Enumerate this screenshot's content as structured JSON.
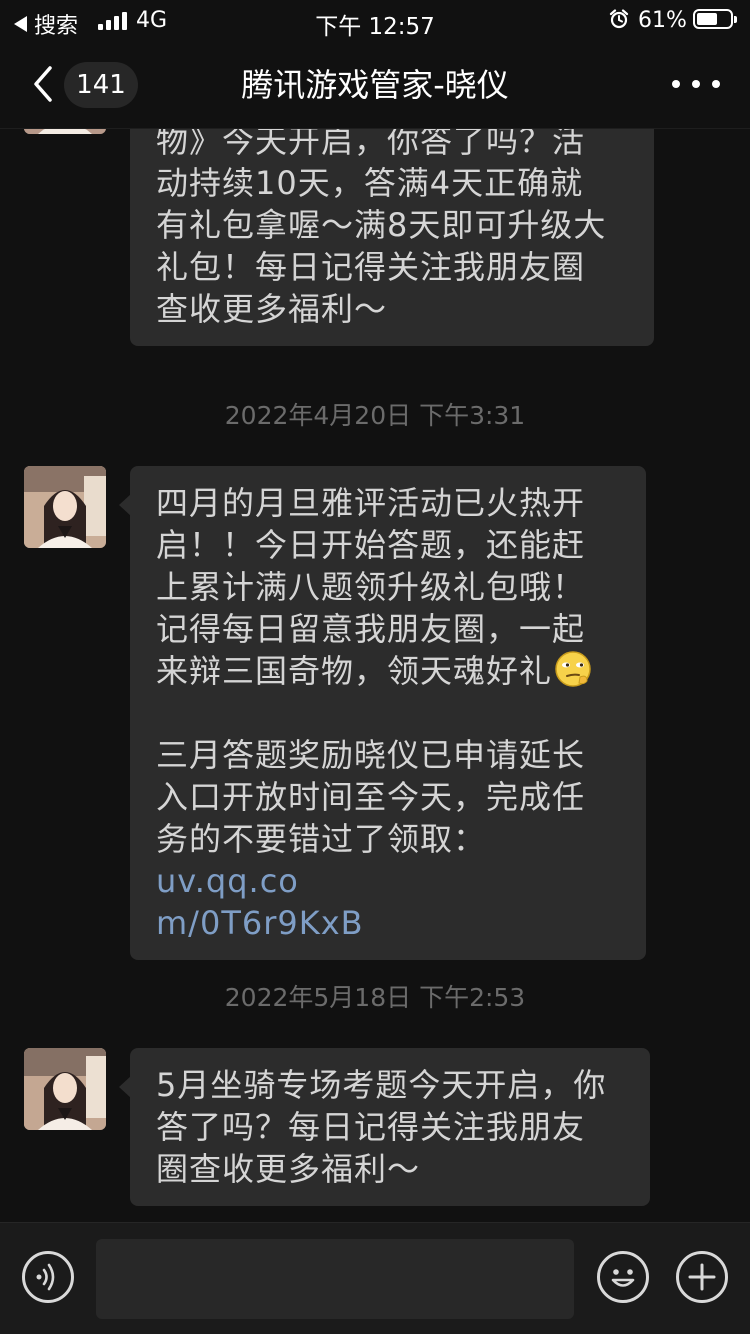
{
  "status_bar": {
    "back_app": "搜索",
    "network": "4G",
    "time": "下午 12:57",
    "battery": "61%",
    "battery_level": 0.61
  },
  "nav": {
    "unread_count": "141",
    "title": "腾讯游戏管家-晓仪",
    "back_icon": "chevron-left-icon",
    "more_icon": "more-dots-icon"
  },
  "messages": [
    {
      "id": "m1",
      "lines": [
        "物》今天开启，你答了吗？活",
        "动持续10天，答满4天正确就",
        "有礼包拿喔～满8天即可升级大",
        "礼包！每日记得关注我朋友圈",
        "查收更多福利～"
      ]
    },
    {
      "id": "m2",
      "timestamp": "2022年4月20日 下午3:31",
      "para1": [
        "四月的月旦雅评活动已火热开",
        "启！！今日开始答题，还能赶",
        "上累计满八题领升级礼包哦！",
        "记得每日留意我朋友圈，一起",
        "来辩三国奇物，领天魂好礼"
      ],
      "para2": [
        "三月答题奖励晓仪已申请延长",
        "入口开放时间至今天，完成任",
        "务的不要错过了领取："
      ],
      "link_part1": "uv.qq.co",
      "link_part2": "m/0T6r9KxB",
      "emoji_icon": "smirk-emoji-icon"
    },
    {
      "id": "m3",
      "timestamp": "2022年5月18日 下午2:53",
      "lines": [
        "5月坐骑专场考题今天开启，你",
        "答了吗？每日记得关注我朋友",
        "圈查收更多福利～"
      ]
    }
  ],
  "input_bar": {
    "value": "",
    "voice_icon": "voice-icon",
    "emoji_icon": "emoji-icon",
    "plus_icon": "plus-icon"
  },
  "colors": {
    "background": "#111111",
    "bubble": "#2c2c2c",
    "text": "#d5d5d5",
    "link": "#7f9ec6",
    "timestamp": "#6b6b6b"
  }
}
